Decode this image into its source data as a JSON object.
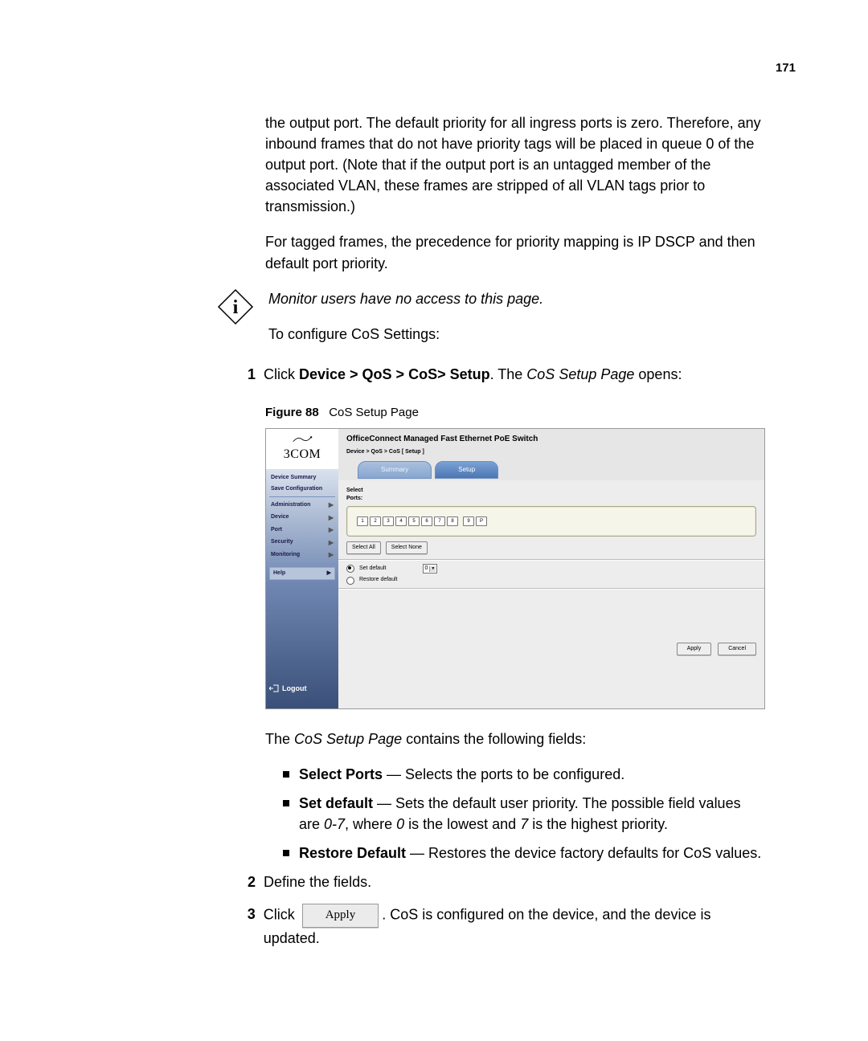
{
  "page_number": "171",
  "intro": {
    "p1": "the output port. The default priority for all ingress ports is zero. Therefore, any inbound frames that do not have priority tags will be placed in queue 0 of the output port. (Note that if the output port is an untagged member of the associated VLAN, these frames are stripped of all VLAN tags prior to transmission.)",
    "p2": "For tagged frames, the precedence for priority mapping is IP DSCP and then default port priority.",
    "note": "Monitor users have no access to this page.",
    "p3": "To configure CoS Settings:"
  },
  "step1": {
    "num": "1",
    "pre": "Click ",
    "bold": "Device > QoS > CoS> Setup",
    "mid": ". The ",
    "italic": "CoS Setup Page",
    "post": " opens:"
  },
  "figure": {
    "label": "Figure 88",
    "caption": "CoS Setup Page"
  },
  "screenshot": {
    "logo": "3COM",
    "nav_top": {
      "summary": "Device Summary",
      "save": "Save Configuration"
    },
    "nav_items": [
      "Administration",
      "Device",
      "Port",
      "Security",
      "Monitoring"
    ],
    "nav_help": "Help",
    "logout": "Logout",
    "title": "OfficeConnect Managed Fast Ethernet PoE Switch",
    "breadcrumb": "Device > QoS > CoS [ Setup ]",
    "tabs": {
      "summary": "Summary",
      "setup": "Setup"
    },
    "select_ports_label": "Select\nPorts:",
    "ports": [
      "1",
      "2",
      "3",
      "4",
      "5",
      "6",
      "7",
      "8"
    ],
    "ports_uplink": [
      "9",
      "P"
    ],
    "btn_select_all": "Select All",
    "btn_select_none": "Select None",
    "radio_set": "Set default",
    "radio_restore": "Restore default",
    "dropdown_value": "0",
    "btn_apply": "Apply",
    "btn_cancel": "Cancel"
  },
  "after_fig": {
    "lead_pre": "The ",
    "lead_italic": "CoS Setup Page",
    "lead_post": " contains the following fields:"
  },
  "bullets": {
    "b1": {
      "bold": "Select Ports",
      "text": " — Selects the ports to be configured."
    },
    "b2": {
      "bold": "Set default",
      "pre": " — Sets the default user priority. The possible field values are ",
      "i1": "0-7",
      "mid1": ", where ",
      "i2": "0",
      "mid2": " is the lowest and ",
      "i3": "7",
      "post": " is the highest priority."
    },
    "b3": {
      "bold": "Restore Default",
      "text": " — Restores the device factory defaults for CoS values."
    }
  },
  "step2": {
    "num": "2",
    "text": "Define the fields."
  },
  "step3": {
    "num": "3",
    "pre": "Click ",
    "btn": "Apply",
    "post": ". CoS is configured on the device, and the device is updated."
  }
}
